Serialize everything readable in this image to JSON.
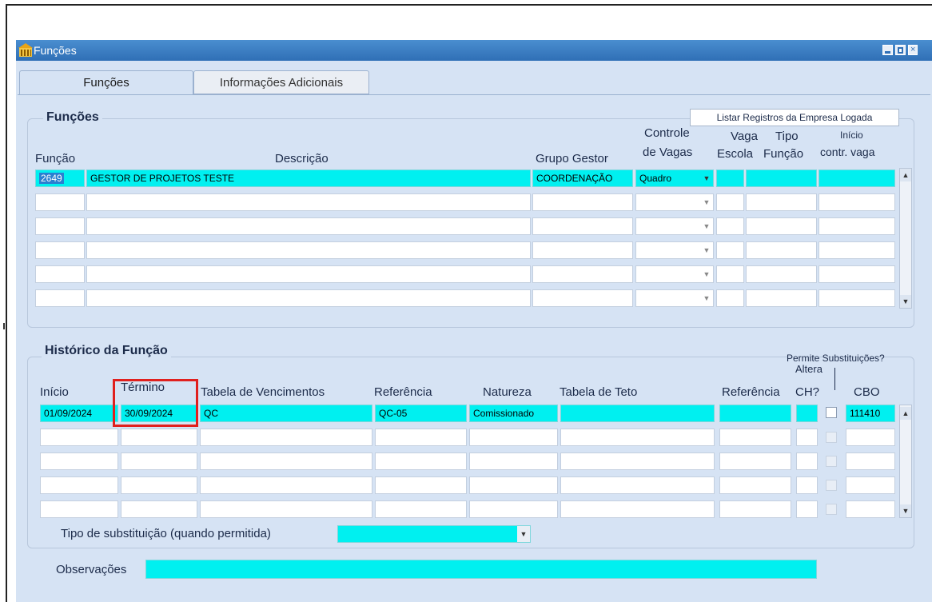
{
  "window": {
    "title": "Funções",
    "icon": "building-icon",
    "controls": [
      "minimize-icon",
      "maximize-icon",
      "close-icon"
    ]
  },
  "tabs": [
    {
      "label": "Funções",
      "active": true
    },
    {
      "label": "Informações Adicionais",
      "active": false
    }
  ],
  "funcoes": {
    "section_title": "Funções",
    "list_button": "Listar Registros da Empresa Logada",
    "headers": {
      "funcao": "Função",
      "descricao": "Descrição",
      "grupo_gestor": "Grupo Gestor",
      "controle_l1": "Controle",
      "controle_l2": "de Vagas",
      "vaga_l1": "Vaga",
      "vaga_l2": "Escola",
      "tipo_l1": "Tipo",
      "tipo_l2": "Função",
      "inicio_l1": "Início",
      "inicio_l2": "contr. vaga"
    },
    "rows": [
      {
        "funcao": "2649",
        "descricao": "GESTOR DE PROJETOS TESTE",
        "grupo": "COORDENAÇÃO",
        "controle": "Quadro",
        "vaga_escola": "",
        "tipo_funcao": "",
        "inicio_contr": ""
      }
    ],
    "empty_rows": 5
  },
  "historico": {
    "section_title": "Histórico da Função",
    "tooltip": "Permite Substituições?",
    "headers": {
      "inicio": "Início",
      "termino": "Término",
      "tabela_venc": "Tabela de Vencimentos",
      "referencia": "Referência",
      "natureza": "Natureza",
      "tabela_teto": "Tabela de Teto",
      "referencia2": "Referência",
      "altera_l1": "Altera",
      "altera_l2": "CH?",
      "cbo": "CBO"
    },
    "rows": [
      {
        "inicio": "01/09/2024",
        "termino": "30/09/2024",
        "tabela": "QC",
        "referencia": "QC-05",
        "natureza": "Comissionado",
        "teto": "",
        "ref2": "",
        "altera": "",
        "cbo": "111410"
      }
    ],
    "empty_rows": 4,
    "tipo_substituicao_label": "Tipo de substituição (quando permitida)",
    "tipo_substituicao_value": "",
    "observacoes_label": "Observações",
    "observacoes_value": ""
  },
  "colors": {
    "field_cyan": "#00f0f0",
    "panel_bg": "#d6e3f4",
    "title_bar": "#2f6fb6",
    "highlight": "#e0201e"
  }
}
